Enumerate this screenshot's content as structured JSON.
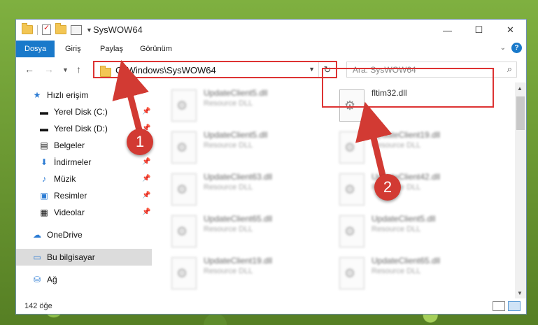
{
  "window": {
    "title": "SysWOW64"
  },
  "window_buttons": {
    "minimize": "—",
    "maximize": "☐",
    "close": "✕"
  },
  "ribbon": {
    "tabs": [
      {
        "label": "Dosya"
      },
      {
        "label": "Giriş"
      },
      {
        "label": "Paylaş"
      },
      {
        "label": "Görünüm"
      }
    ],
    "help": "?"
  },
  "address": {
    "path": "C:\\Windows\\SysWOW64"
  },
  "search": {
    "placeholder": "Ara: SysWOW64"
  },
  "nav": {
    "items": [
      {
        "label": "Hızlı erişim",
        "icon": "star-icon"
      },
      {
        "label": "Yerel Disk (C:)",
        "icon": "drive-icon"
      },
      {
        "label": "Yerel Disk (D:)",
        "icon": "drive-icon"
      },
      {
        "label": "Belgeler",
        "icon": "documents-icon"
      },
      {
        "label": "İndirmeler",
        "icon": "download-icon"
      },
      {
        "label": "Müzik",
        "icon": "music-icon"
      },
      {
        "label": "Resimler",
        "icon": "pictures-icon"
      },
      {
        "label": "Videolar",
        "icon": "video-icon"
      },
      {
        "label": "OneDrive",
        "icon": "cloud-icon"
      },
      {
        "label": "Bu bilgisayar",
        "icon": "computer-icon"
      },
      {
        "label": "Ağ",
        "icon": "network-icon"
      }
    ]
  },
  "files": {
    "left": [
      {
        "name": "UpdateClient5.dll",
        "type": "Resource DLL"
      },
      {
        "name": "UpdateClient5.dll",
        "type": "Resource DLL"
      },
      {
        "name": "UpdateClient63.dll",
        "type": "Resource DLL"
      },
      {
        "name": "UpdateClient65.dll",
        "type": "Resource DLL"
      },
      {
        "name": "UpdateClient19.dll",
        "type": "Resource DLL"
      }
    ],
    "highlighted": {
      "name": "fltim32.dll"
    },
    "right": [
      {
        "name": "UpdateClient19.dll",
        "type": "Resource DLL"
      },
      {
        "name": "UpdateClient42.dll",
        "type": "Resource DLL"
      },
      {
        "name": "UpdateClient5.dll",
        "type": "Resource DLL"
      },
      {
        "name": "UpdateClient65.dll",
        "type": "Resource DLL"
      }
    ]
  },
  "status": {
    "count": "142 öğe"
  },
  "markers": {
    "one": "1",
    "two": "2"
  },
  "colors": {
    "accent": "#1979ca",
    "marker": "#d23a33"
  }
}
